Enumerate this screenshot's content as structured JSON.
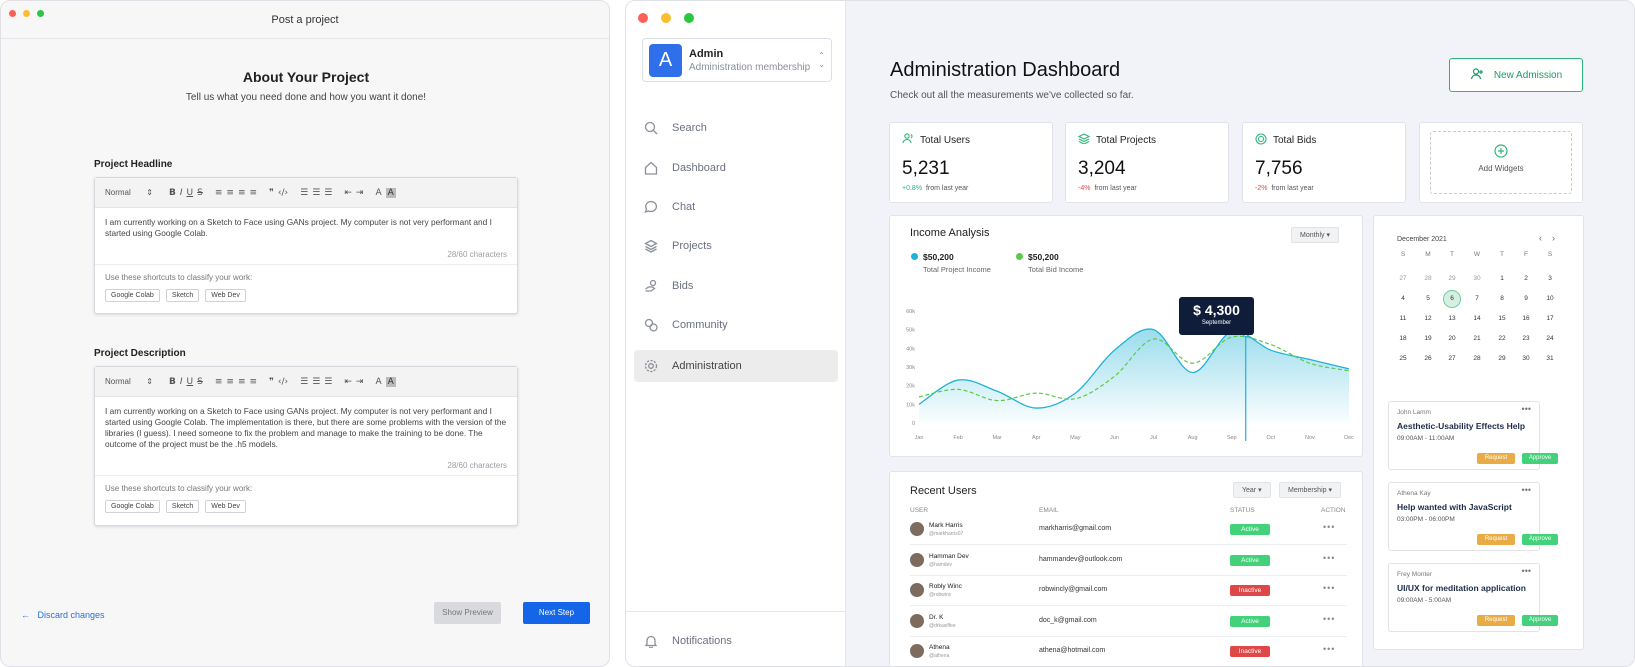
{
  "post_window": {
    "title": "Post a project",
    "heading": "About Your Project",
    "subheading": "Tell us what you need done and how you want it done!",
    "toolbar": {
      "style_select": "Normal",
      "select_arrow": "⇕"
    },
    "headline": {
      "label": "Project Headline",
      "text": "I am currently working on a Sketch to Face using GANs project. My computer is not very performant and I started using Google Colab.",
      "count": "28/60 characters",
      "shortcuts_label": "Use these shortcuts to classify your work:",
      "chips": [
        "Google Colab",
        "Sketch",
        "Web Dev"
      ]
    },
    "description": {
      "label": "Project Description",
      "text": "I am currently working on a Sketch to Face using GANs project. My computer is not very performant and I started using Google Colab. The implementation is there, but there are some problems with the version of the libraries (I guess). I need someone to fix the problem and manage to make the training to be done. The outcome of the project must be the .h5 models.",
      "count": "28/60 characters",
      "shortcuts_label": "Use these shortcuts to classify your work:",
      "chips": [
        "Google Colab",
        "Sketch",
        "Web Dev"
      ]
    },
    "discard": "Discard changes",
    "show_preview": "Show Preview",
    "next_step": "Next Step"
  },
  "dashboard": {
    "account": {
      "initial": "A",
      "name": "Admin",
      "membership": "Administration membership"
    },
    "nav": [
      "Search",
      "Dashboard",
      "Chat",
      "Projects",
      "Bids",
      "Community",
      "Administration"
    ],
    "notifications": "Notifications",
    "title": "Administration Dashboard",
    "subtitle": "Check out all the measurements we've collected so far.",
    "new_admission": "New Admission",
    "stats": [
      {
        "label": "Total Users",
        "value": "5,231",
        "change": "+0.8%",
        "change_suffix": "from last year",
        "color": "#2fb67c"
      },
      {
        "label": "Total Projects",
        "value": "3,204",
        "change": "-4%",
        "change_suffix": "from last year",
        "color": "#e04848"
      },
      {
        "label": "Total Bids",
        "value": "7,756",
        "change": "-2%",
        "change_suffix": "from last year",
        "color": "#e04848"
      }
    ],
    "add_widgets": "Add Widgets",
    "income": {
      "title": "Income Analysis",
      "period": "Monthly",
      "legend": [
        {
          "value": "$50,200",
          "label": "Total Project Income",
          "color": "#1fb2d6"
        },
        {
          "value": "$50,200",
          "label": "Total Bid Income",
          "color": "#5cc94a"
        }
      ],
      "tooltip_value": "$ 4,300",
      "tooltip_month": "September"
    },
    "recent_users": {
      "title": "Recent Users",
      "filter_year": "Year",
      "filter_membership": "Membership",
      "headers": [
        "USER",
        "EMAIL",
        "STATUS",
        "ACTION"
      ],
      "rows": [
        {
          "name": "Mark Harris",
          "handle": "@markharris07",
          "email": "markharris@gmail.com",
          "status": "Active"
        },
        {
          "name": "Hamman Dev",
          "handle": "@hamdev",
          "email": "hammandev@outlook.com",
          "status": "Active"
        },
        {
          "name": "Robly Winc",
          "handle": "@robwinc",
          "email": "robwincly@gmail.com",
          "status": "Inactive"
        },
        {
          "name": "Dr. K",
          "handle": "@drkasiffee",
          "email": "doc_k@gmail.com",
          "status": "Active"
        },
        {
          "name": "Athena",
          "handle": "@athena",
          "email": "athena@hotmail.com",
          "status": "Inactive"
        }
      ]
    },
    "calendar": {
      "month": "December 2021",
      "weekdays": [
        "S",
        "M",
        "T",
        "W",
        "T",
        "F",
        "S"
      ],
      "days": [
        "27",
        "28",
        "29",
        "30",
        "1",
        "2",
        "3",
        "4",
        "5",
        "6",
        "7",
        "8",
        "9",
        "10",
        "11",
        "12",
        "13",
        "14",
        "15",
        "16",
        "17",
        "18",
        "19",
        "20",
        "21",
        "22",
        "23",
        "24",
        "25",
        "26",
        "27",
        "28",
        "29",
        "30",
        "31"
      ],
      "selected": "6"
    },
    "tasks": [
      {
        "owner": "John Lamm",
        "title": "Aesthetic-Usability Effects Help",
        "time": "09:00AM - 11:00AM"
      },
      {
        "owner": "Athena Kay",
        "title": "Help wanted with JavaScript",
        "time": "03:00PM - 06:00PM"
      },
      {
        "owner": "Frey Monter",
        "title": "UI/UX for meditation application",
        "time": "09:00AM - 5:00AM"
      }
    ],
    "task_actions": {
      "request": "Request",
      "approve": "Approve"
    }
  },
  "chart_data": {
    "type": "area",
    "title": "Income Analysis",
    "x": [
      "Jan",
      "Feb",
      "Mar",
      "Apr",
      "May",
      "Jun",
      "Jul",
      "Aug",
      "Sep",
      "Oct",
      "Nov",
      "Dec"
    ],
    "y_ticks": [
      "0",
      "10k",
      "20k",
      "30k",
      "40k",
      "50k",
      "60k"
    ],
    "ylim": [
      0,
      60
    ],
    "series": [
      {
        "name": "Total Project Income",
        "values": [
          10,
          23,
          17,
          8,
          16,
          39,
          50,
          27,
          49,
          39,
          34,
          29
        ]
      },
      {
        "name": "Total Bid Income",
        "values": [
          14,
          18,
          12,
          16,
          13,
          25,
          45,
          32,
          46,
          42,
          32,
          28
        ]
      }
    ]
  }
}
